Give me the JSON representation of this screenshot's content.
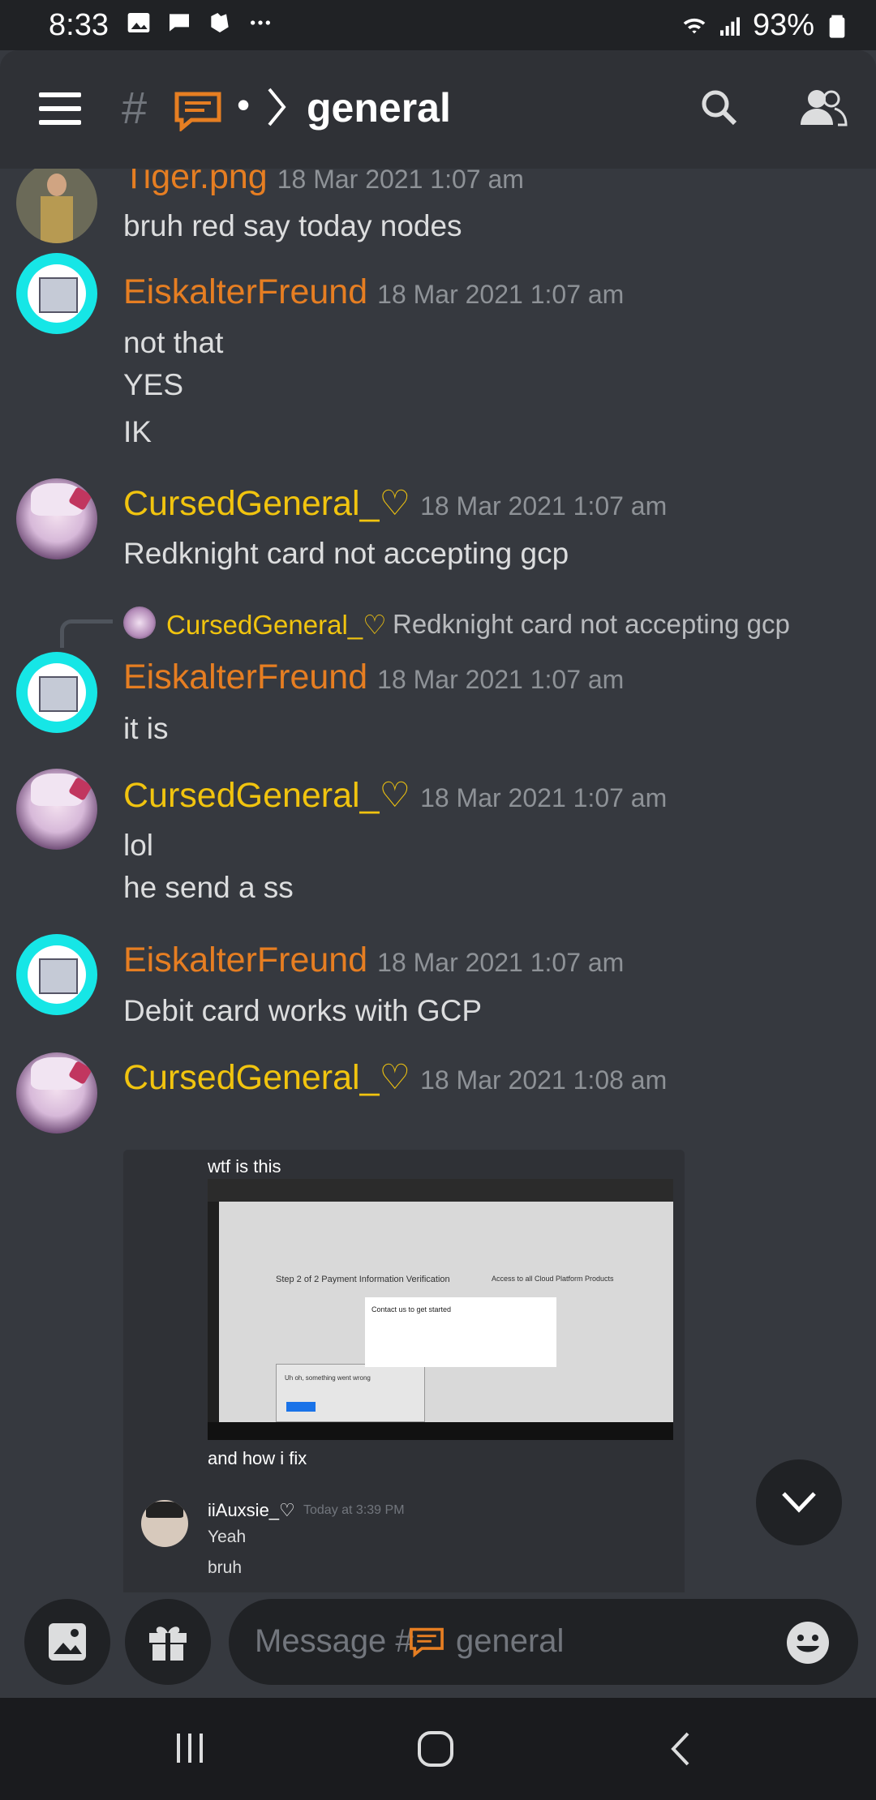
{
  "status": {
    "time": "8:33",
    "battery": "93%"
  },
  "header": {
    "hash": "#",
    "separator": "•",
    "channel": "general"
  },
  "messages": [
    {
      "author": "Tiger.png",
      "timestamp": "18 Mar 2021 1:07 am",
      "lines": [
        "bruh red say today nodes"
      ]
    },
    {
      "author": "EiskalterFreund",
      "timestamp": "18 Mar 2021 1:07 am",
      "lines": [
        "not that",
        "YES",
        "IK"
      ]
    },
    {
      "author": "CursedGeneral_♡",
      "timestamp": "18 Mar 2021 1:07 am",
      "lines": [
        "Redknight card not accepting gcp"
      ]
    },
    {
      "author": "EiskalterFreund",
      "timestamp": "18 Mar 2021 1:07 am",
      "lines": [
        "it is"
      ],
      "reply": {
        "author": "CursedGeneral_♡",
        "text": "Redknight card not accepting gcp"
      }
    },
    {
      "author": "CursedGeneral_♡",
      "timestamp": "18 Mar 2021 1:07 am",
      "lines": [
        "lol",
        "he send a ss"
      ]
    },
    {
      "author": "EiskalterFreund",
      "timestamp": "18 Mar 2021 1:07 am",
      "lines": [
        "Debit card works with GCP"
      ]
    },
    {
      "author": "CursedGeneral_♡",
      "timestamp": "18 Mar 2021 1:08 am",
      "lines": []
    }
  ],
  "attachment": {
    "caption_top": "wtf is this",
    "caption_bottom": "and how i fix",
    "screenshot_heading": "Step 2 of 2 Payment Information Verification",
    "screenshot_side": "Access to all Cloud Platform Products",
    "screenshot_modal": "Contact us to get started",
    "screenshot_error": "Uh oh, something went wrong",
    "nested_author": "iiAuxsie_♡",
    "nested_time": "Today at 3:39 PM",
    "nested_lines": [
      "Yeah",
      "bruh"
    ]
  },
  "composer": {
    "placeholder": "Message #",
    "channel": "general"
  },
  "colors": {
    "background": "#36393f",
    "header": "#2f3136",
    "orange": "#e67e22",
    "yellow": "#f1c40f"
  }
}
